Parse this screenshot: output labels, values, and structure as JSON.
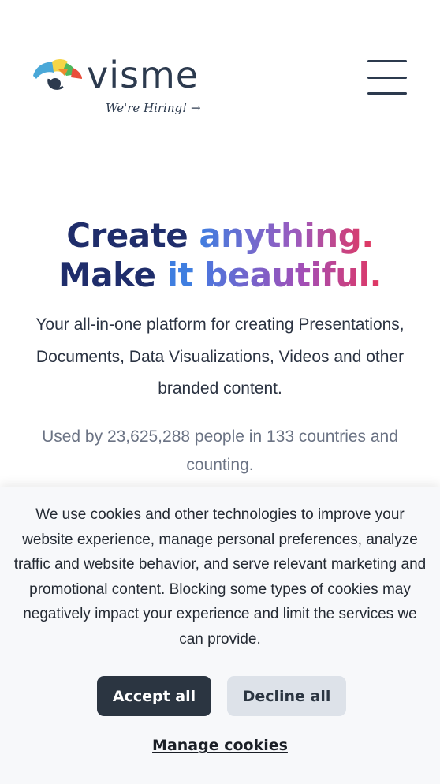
{
  "header": {
    "logo_text": "visme",
    "hiring_text": "We're Hiring!",
    "hiring_arrow": "→",
    "menu_icon": "hamburger-menu-icon"
  },
  "hero": {
    "title_line1": {
      "part1": "Create ",
      "part2": "anything."
    },
    "title_line2": {
      "part1": "Make ",
      "part2": "it ",
      "part3": "beautiful."
    },
    "subtitle": "Your all-in-one platform for creating Presentations, Documents, Data Visualizations, Videos and other branded content.",
    "users_text": "Used by 23,625,288 people in 133 countries and counting."
  },
  "cookie_banner": {
    "text": "We use cookies and other technologies to improve your website experience, manage personal preferences, analyze traffic and website behavior, and serve relevant marketing and promotional content. Blocking some types of cookies may negatively impact your experience and limit the services we can provide.",
    "accept_label": "Accept all",
    "decline_label": "Decline all",
    "manage_label": "Manage cookies"
  },
  "colors": {
    "brand_dark": "#1f2d6b",
    "brand_blue": "#3f7ee0",
    "brand_pink": "#e2365f",
    "button_dark": "#2b3541",
    "button_light": "#dde2e9"
  }
}
